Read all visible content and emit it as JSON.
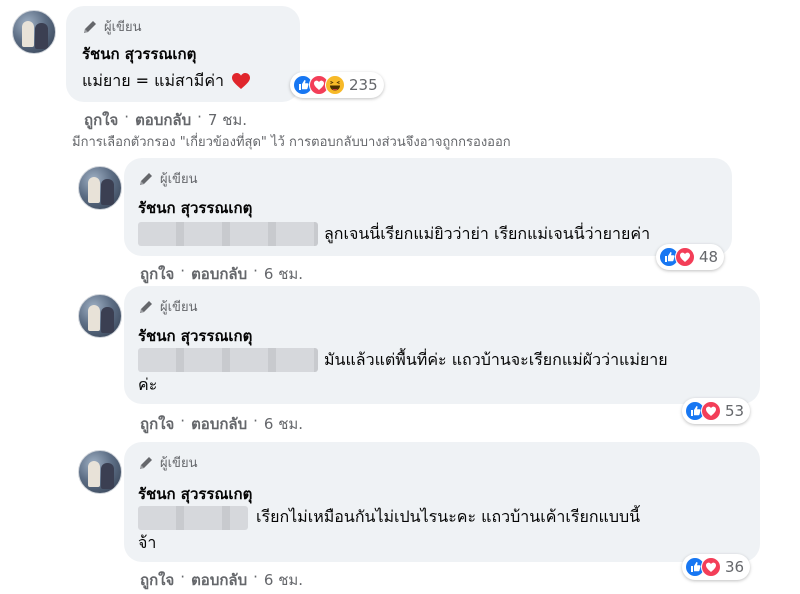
{
  "filter_note": "มีการเลือกตัวกรอง \"เกี่ยวข้องที่สุด\" ไว้ การตอบกลับบางส่วนจึงอาจถูกกรองออก",
  "comments": [
    {
      "author_badge": "ผู้เขียน",
      "author": "รัชนก สุวรรณเกตุ",
      "text_line1": "แม่ยาย = แม่สามีค่า",
      "reaction_count": "235",
      "like_label": "ถูกใจ",
      "reply_label": "ตอบกลับ",
      "time": "7 ชม."
    },
    {
      "author_badge": "ผู้เขียน",
      "author": "รัชนก สุวรรณเกตุ",
      "text_line1": "ลูกเจนนี่เรียกแม่ยิวว่าย่า เรียกแม่เจนนี่ว่ายายค่า",
      "reaction_count": "48",
      "like_label": "ถูกใจ",
      "reply_label": "ตอบกลับ",
      "time": "6 ชม."
    },
    {
      "author_badge": "ผู้เขียน",
      "author": "รัชนก สุวรรณเกตุ",
      "text_line1": "มันแล้วแต่พื้นที่ค่ะ แถวบ้านจะเรียกแม่ผัวว่าแม่ยาย",
      "text_line2": "ค่ะ",
      "reaction_count": "53",
      "like_label": "ถูกใจ",
      "reply_label": "ตอบกลับ",
      "time": "6 ชม."
    },
    {
      "author_badge": "ผู้เขียน",
      "author": "รัชนก สุวรรณเกตุ",
      "text_line1": "เรียกไม่เหมือนกันไม่เปนไรนะคะ แถวบ้านเค้าเรียกแบบนี้",
      "text_line2": "จ้า",
      "reaction_count": "36",
      "like_label": "ถูกใจ",
      "reply_label": "ตอบกลับ",
      "time": "6 ชม."
    }
  ],
  "colors": {
    "bubble": "#eff2f5",
    "like_blue": "#1877f2",
    "love_red": "#f33e58",
    "haha_yellow": "#f7b928",
    "meta_gray": "#65676b"
  },
  "icons": {
    "author_badge": "pencil-icon",
    "heart": "heart-emoji-icon",
    "reactions": [
      "like-reaction-icon",
      "love-reaction-icon",
      "haha-reaction-icon"
    ]
  }
}
